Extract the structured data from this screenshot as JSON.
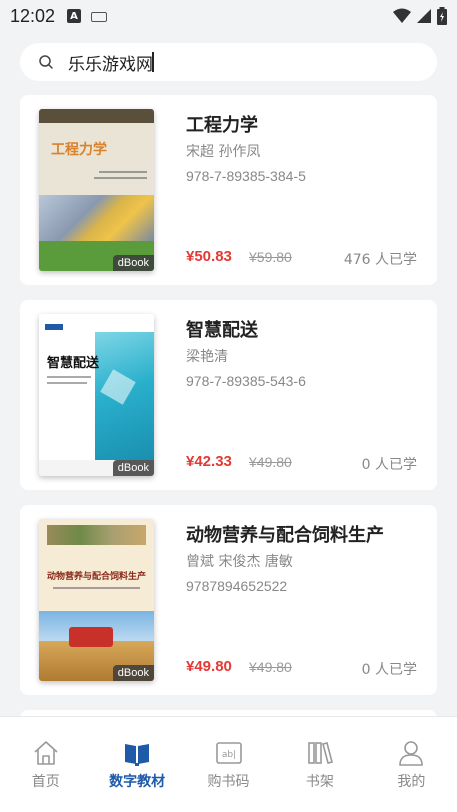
{
  "status_bar": {
    "time": "12:02",
    "a_icon": "A"
  },
  "search": {
    "value": "乐乐游戏网"
  },
  "books": [
    {
      "title": "工程力学",
      "author": "宋超 孙作凤",
      "isbn": "978-7-89385-384-5",
      "price": "¥50.83",
      "original_price": "¥59.80",
      "learners": "476 人已学",
      "tag": "dBook",
      "cover_title": "工程力学",
      "cover_color": "#e8e3d5"
    },
    {
      "title": "智慧配送",
      "author": "梁艳清",
      "isbn": "978-7-89385-543-6",
      "price": "¥42.33",
      "original_price": "¥49.80",
      "learners": "0 人已学",
      "tag": "dBook",
      "cover_title": "智慧配送",
      "cover_color": "#ffffff"
    },
    {
      "title": "动物营养与配合饲料生产",
      "author": "曾斌 宋俊杰 唐敏",
      "isbn": "9787894652522",
      "price": "¥49.80",
      "original_price": "¥49.80",
      "learners": "0 人已学",
      "tag": "dBook",
      "cover_title": "动物营养与配合饲料生产",
      "cover_color": "#f6ecd6"
    }
  ],
  "nav": [
    {
      "label": "首页",
      "icon": "home-icon",
      "active": false
    },
    {
      "label": "数字教材",
      "icon": "book-icon",
      "active": true
    },
    {
      "label": "购书码",
      "icon": "code-icon",
      "active": false
    },
    {
      "label": "书架",
      "icon": "shelf-icon",
      "active": false
    },
    {
      "label": "我的",
      "icon": "user-icon",
      "active": false
    }
  ],
  "colors": {
    "accent": "#1e5aa8",
    "price": "#e53935"
  }
}
